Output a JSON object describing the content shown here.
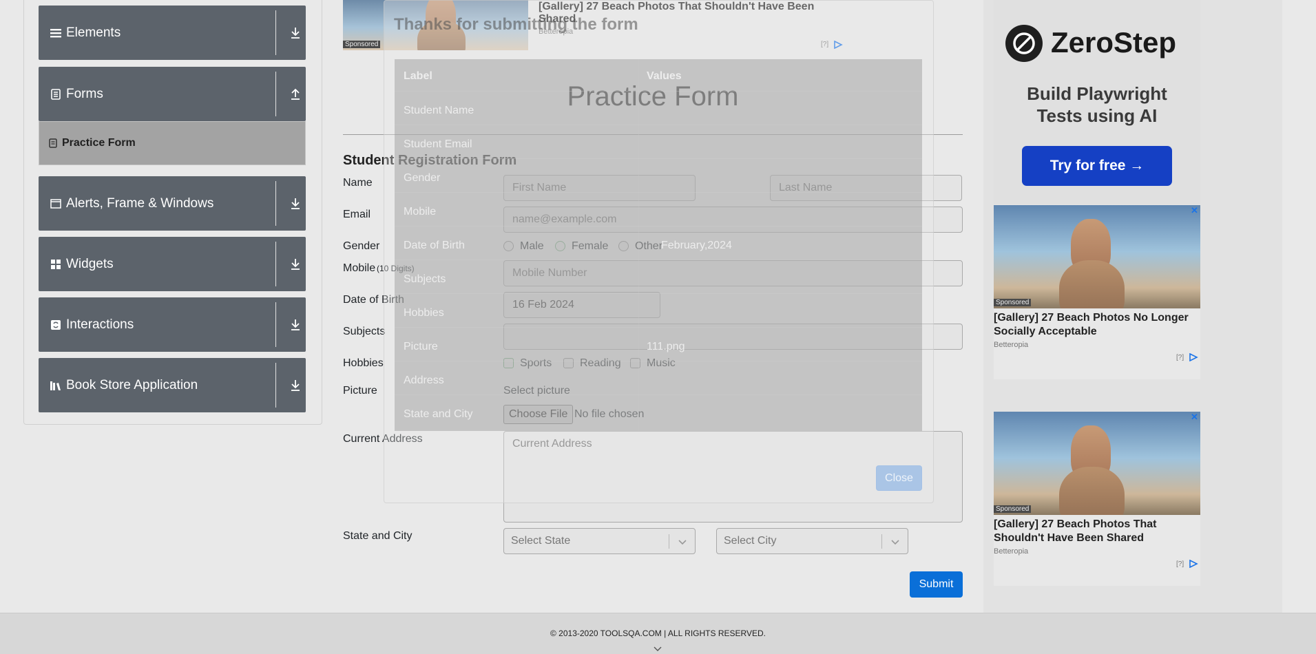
{
  "sidebar": {
    "groups": [
      {
        "label": "Elements",
        "icon": "hamburger-icon",
        "arrow": "download-icon"
      },
      {
        "label": "Forms",
        "icon": "document-icon",
        "arrow": "upload-icon"
      },
      {
        "label": "Alerts, Frame & Windows",
        "icon": "window-icon",
        "arrow": "download-icon"
      },
      {
        "label": "Widgets",
        "icon": "widgets-icon",
        "arrow": "download-icon"
      },
      {
        "label": "Interactions",
        "icon": "interactions-icon",
        "arrow": "download-icon"
      },
      {
        "label": "Book Store Application",
        "icon": "books-icon",
        "arrow": "download-icon"
      }
    ],
    "active_item": "Practice Form"
  },
  "top_ad": {
    "title_line1": "[Gallery] 27 Beach Photos That Shouldn't Have Been",
    "title_line2": "Shared",
    "source": "Betteropia",
    "sponsored": "Sponsored",
    "info": "[?]"
  },
  "main": {
    "page_title": "Practice Form",
    "form_title": "Student Registration Form",
    "labels": {
      "name": "Name",
      "email": "Email",
      "gender": "Gender",
      "mobile": "Mobile",
      "mobile_hint": "(10 Digits)",
      "dob": "Date of Birth",
      "subjects": "Subjects",
      "hobbies": "Hobbies",
      "picture": "Picture",
      "address": "Current Address",
      "state_city": "State and City"
    },
    "first_name_placeholder": "First Name",
    "last_name_placeholder": "Last Name",
    "email_placeholder": "name@example.com",
    "gender_options": [
      "Male",
      "Female",
      "Other"
    ],
    "mobile_placeholder": "Mobile Number",
    "dob_value": "16 Feb 2024",
    "hobby_options": [
      "Sports",
      "Reading",
      "Music"
    ],
    "select_picture": "Select picture",
    "choose_file": "Choose File",
    "no_file": "No file chosen",
    "address_placeholder": "Current Address",
    "state_placeholder": "Select State",
    "city_placeholder": "Select City",
    "submit": "Submit"
  },
  "modal": {
    "title": "Thanks for submitting the form",
    "header_label": "Label",
    "header_values": "Values",
    "rows": [
      {
        "label": "Student Name",
        "value": ""
      },
      {
        "label": "Student Email",
        "value": ""
      },
      {
        "label": "Gender",
        "value": ""
      },
      {
        "label": "Mobile",
        "value": ""
      },
      {
        "label": "Date of Birth",
        "value": "February,2024"
      },
      {
        "label": "Subjects",
        "value": ""
      },
      {
        "label": "Hobbies",
        "value": ""
      },
      {
        "label": "Picture",
        "value": "111.png"
      },
      {
        "label": "Address",
        "value": ""
      },
      {
        "label": "State and City",
        "value": ""
      }
    ],
    "close": "Close"
  },
  "right_ads": {
    "zerostep_brand": "ZeroStep",
    "zerostep_tagline_1": "Build Playwright",
    "zerostep_tagline_2": "Tests using AI",
    "zerostep_cta": "Try for free →",
    "ad1_title_1": "[Gallery] 27 Beach Photos No Longer",
    "ad1_title_2": "Socially Acceptable",
    "ad1_source": "Betteropia",
    "ad2_title_1": "[Gallery] 27 Beach Photos That",
    "ad2_title_2": "Shouldn't Have Been Shared",
    "ad2_source": "Betteropia",
    "sponsored": "Sponsored",
    "info": "[?]",
    "close": "✕"
  },
  "footer": {
    "text": "© 2013-2020 TOOLSQA.COM | ALL RIGHTS RESERVED."
  },
  "colors": {
    "sidebar_group": "#5c636b",
    "submit": "#0a6fd8",
    "zerostep_cta": "#1540c4"
  }
}
